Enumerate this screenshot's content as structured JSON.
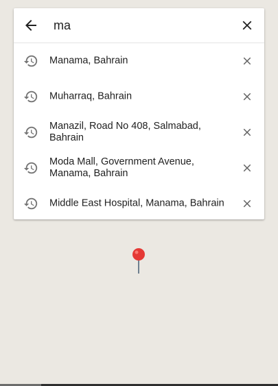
{
  "search": {
    "query": "ma",
    "back_icon": "arrow-back-icon",
    "clear_icon": "close-icon"
  },
  "suggestions": [
    {
      "label": "Manama, Bahrain",
      "icon": "history-icon",
      "action_icon": "close-icon"
    },
    {
      "label": "Muharraq, Bahrain",
      "icon": "history-icon",
      "action_icon": "close-icon"
    },
    {
      "label": "Manazil, Road No 408, Salmabad, Bahrain",
      "icon": "history-icon",
      "action_icon": "close-icon"
    },
    {
      "label": "Moda Mall, Government Avenue, Manama, Bahrain",
      "icon": "history-icon",
      "action_icon": "close-icon"
    },
    {
      "label": "Middle East Hospital, Manama, Bahrain",
      "icon": "history-icon",
      "action_icon": "close-icon"
    }
  ],
  "map": {
    "background_color": "#ebe8e2",
    "pin_icon": "map-pin-icon",
    "pin_color": "#e53935"
  }
}
